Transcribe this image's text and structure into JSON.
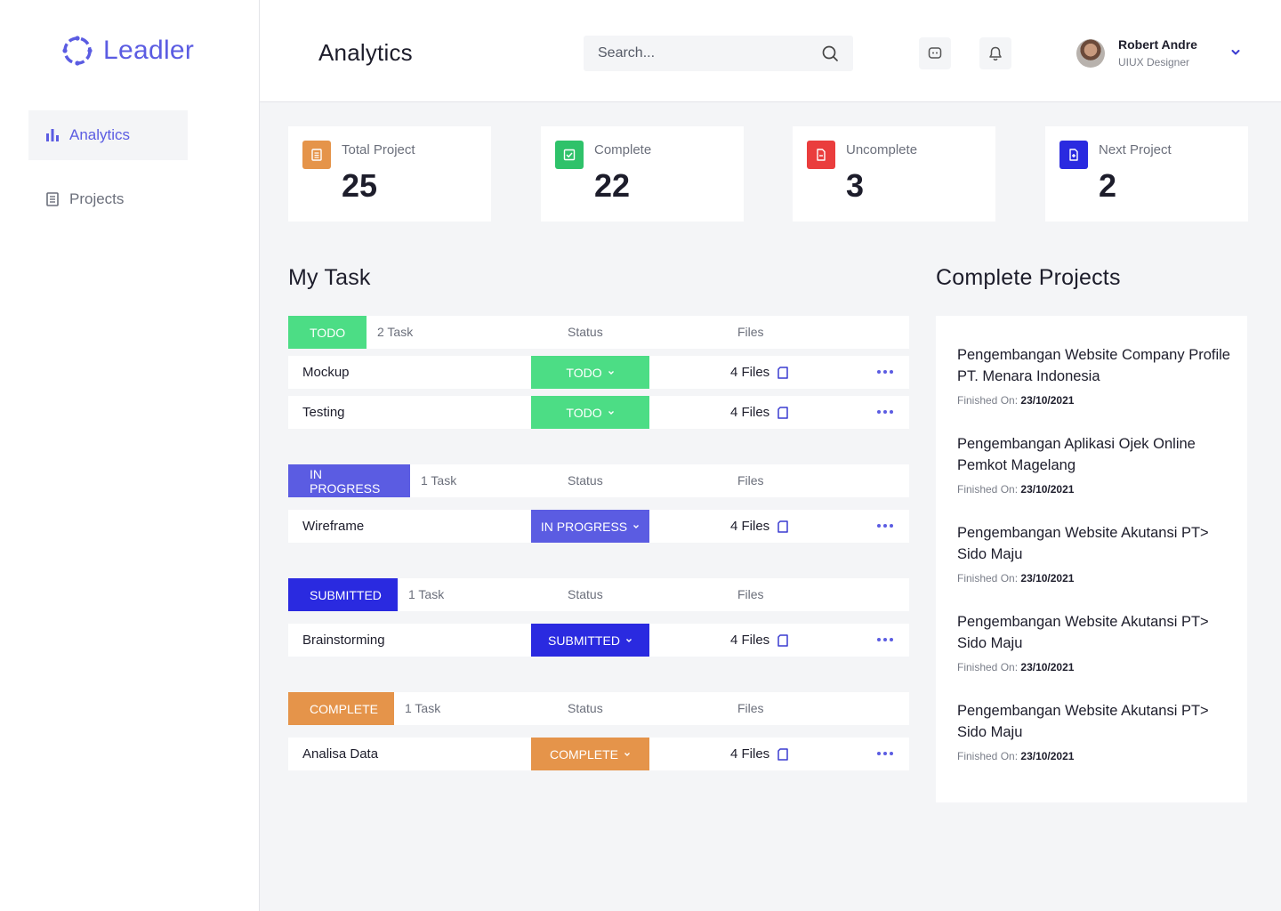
{
  "app": {
    "name": "Leadler"
  },
  "colors": {
    "accent": "#5b5ce2",
    "todo": "#4cdd85",
    "in_progress": "#5b5ce2",
    "submitted": "#2a2ae0",
    "complete": "#e5944a",
    "total_icon": "#e5944a",
    "complete_icon": "#2fc26a",
    "uncomplete_icon": "#ea3d3d",
    "next_icon": "#2a2ae0"
  },
  "sidebar": {
    "items": [
      {
        "label": "Analytics",
        "icon": "bar-chart-icon",
        "active": true
      },
      {
        "label": "Projects",
        "icon": "document-icon",
        "active": false
      }
    ]
  },
  "header": {
    "title": "Analytics",
    "search_placeholder": "Search...",
    "user": {
      "name": "Robert Andre",
      "role": "UIUX Designer"
    }
  },
  "stats": [
    {
      "label": "Total Project",
      "value": "25",
      "icon": "document-list-icon"
    },
    {
      "label": "Complete",
      "value": "22",
      "icon": "check-square-icon"
    },
    {
      "label": "Uncomplete",
      "value": "3",
      "icon": "file-minus-icon"
    },
    {
      "label": "Next Project",
      "value": "2",
      "icon": "file-plus-icon"
    }
  ],
  "my_task": {
    "title": "My Task",
    "status_header": "Status",
    "files_header": "Files",
    "groups": [
      {
        "tag": "TODO",
        "count": "2 Task",
        "rows": [
          {
            "name": "Mockup",
            "status": "TODO",
            "files": "4 Files"
          },
          {
            "name": "Testing",
            "status": "TODO",
            "files": "4 Files"
          }
        ]
      },
      {
        "tag": "IN PROGRESS",
        "count": "1 Task",
        "rows": [
          {
            "name": "Wireframe",
            "status": "IN PROGRESS",
            "files": "4 Files"
          }
        ]
      },
      {
        "tag": "SUBMITTED",
        "count": "1 Task",
        "rows": [
          {
            "name": "Brainstorming",
            "status": "SUBMITTED",
            "files": "4 Files"
          }
        ]
      },
      {
        "tag": "COMPLETE",
        "count": "1 Task",
        "rows": [
          {
            "name": "Analisa Data",
            "status": "COMPLETE",
            "files": "4 Files"
          }
        ]
      }
    ]
  },
  "complete_projects": {
    "title": "Complete Projects",
    "finished_label": "Finished On:",
    "items": [
      {
        "title": "Pengembangan Website Company Profile PT. Menara Indonesia",
        "date": "23/10/2021"
      },
      {
        "title": "Pengembangan Aplikasi Ojek Online Pemkot Magelang",
        "date": "23/10/2021"
      },
      {
        "title": "Pengembangan Website Akutansi PT> Sido Maju",
        "date": "23/10/2021"
      },
      {
        "title": "Pengembangan Website Akutansi PT> Sido Maju",
        "date": "23/10/2021"
      },
      {
        "title": "Pengembangan Website Akutansi PT> Sido Maju",
        "date": "23/10/2021"
      }
    ]
  }
}
